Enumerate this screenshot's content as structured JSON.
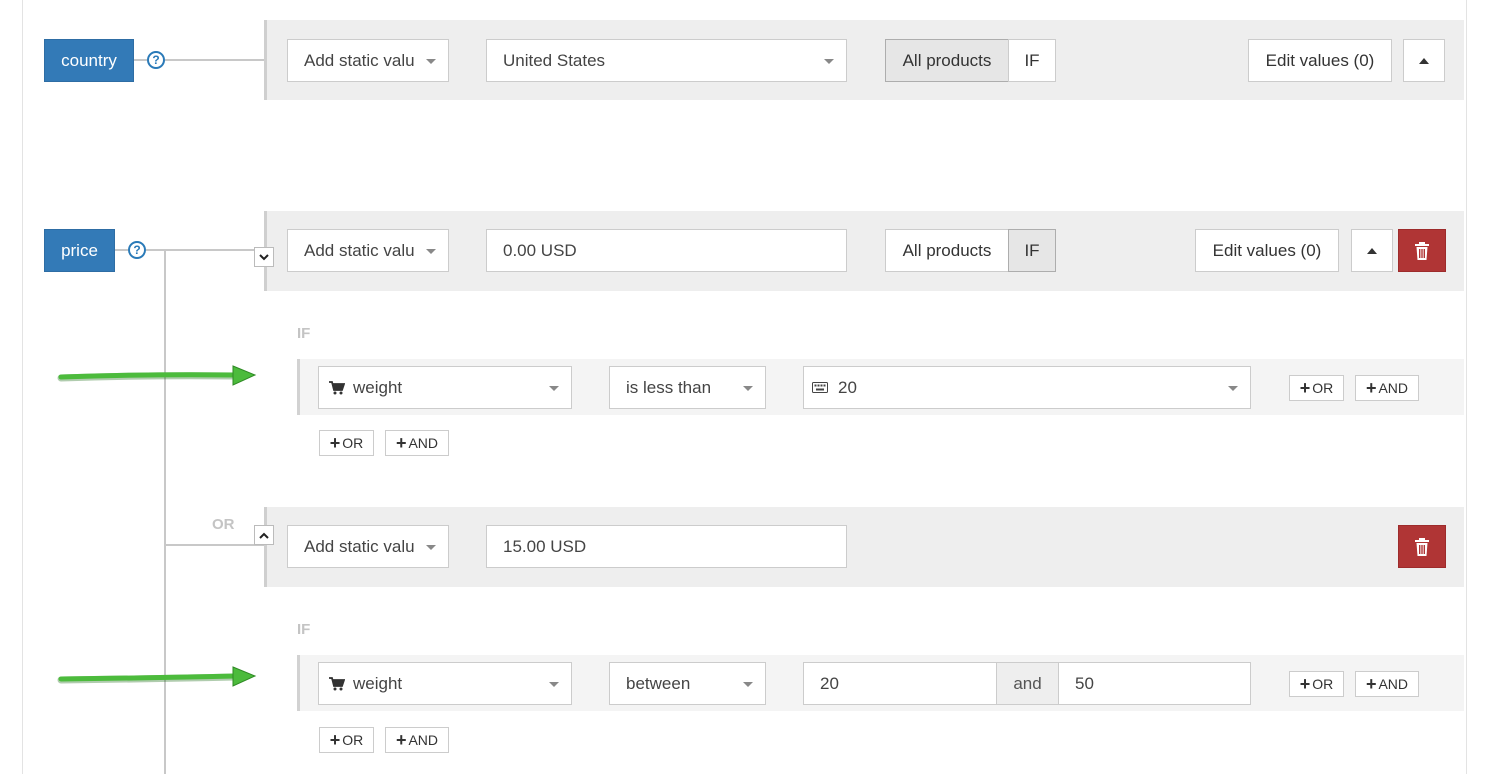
{
  "country": {
    "label": "country",
    "help": "?",
    "source_select": "Add static valu",
    "value_select": "United States",
    "scope_all": "All products",
    "scope_if": "IF",
    "edit_values": "Edit values (0)"
  },
  "price": {
    "label": "price",
    "help": "?",
    "rule1": {
      "source_select": "Add static valu",
      "value": "0.00 USD",
      "scope_all": "All products",
      "scope_if": "IF",
      "edit_values": "Edit values (0)",
      "if_label": "IF",
      "condition": {
        "attribute": "weight",
        "operator": "is less than",
        "value": "20"
      },
      "cond_or": "OR",
      "cond_and": "AND",
      "group_or": "OR",
      "group_and": "AND"
    },
    "or_label": "OR",
    "rule2": {
      "source_select": "Add static valu",
      "value": "15.00 USD",
      "if_label": "IF",
      "condition": {
        "attribute": "weight",
        "operator": "between",
        "value_from": "20",
        "and_label": "and",
        "value_to": "50"
      },
      "cond_or": "OR",
      "cond_and": "AND",
      "group_or": "OR",
      "group_and": "AND"
    }
  },
  "colors": {
    "primary": "#337ab7",
    "danger": "#b03535",
    "annotation_arrow": "#4cbb3c"
  },
  "icons": [
    "help-icon",
    "chevron-down-icon",
    "chevron-up-icon",
    "caret-up-icon",
    "trash-icon",
    "cart-icon",
    "keyboard-icon",
    "plus-icon",
    "arrow-annotation"
  ]
}
